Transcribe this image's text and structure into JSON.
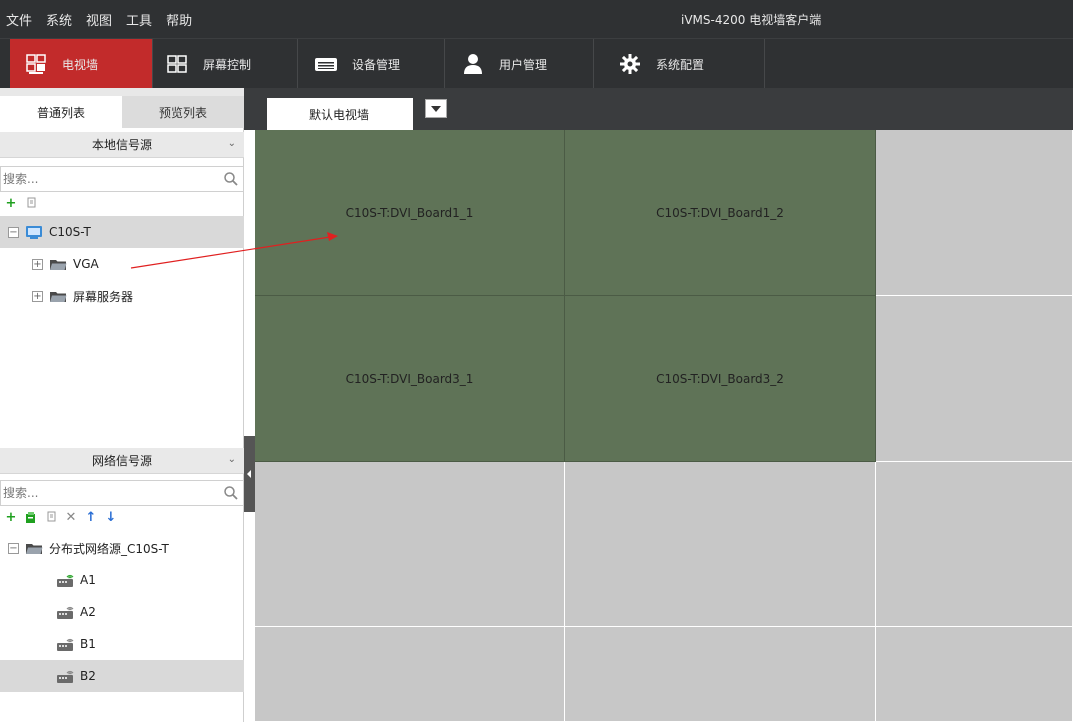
{
  "menu": {
    "items": [
      "文件",
      "系统",
      "视图",
      "工具",
      "帮助"
    ],
    "app_title": "iVMS-4200 电视墙客户端"
  },
  "toolbar": {
    "buttons": [
      {
        "label": "电视墙",
        "icon": "video-wall-icon",
        "active": true
      },
      {
        "label": "屏幕控制",
        "icon": "screen-grid-icon",
        "active": false
      },
      {
        "label": "设备管理",
        "icon": "device-icon",
        "active": false
      },
      {
        "label": "用户管理",
        "icon": "user-icon",
        "active": false
      },
      {
        "label": "系统配置",
        "icon": "gear-icon",
        "active": false
      }
    ]
  },
  "leftpanel": {
    "tabs": [
      "普通列表",
      "预览列表"
    ],
    "local": {
      "header": "本地信号源",
      "search_placeholder": "搜索...",
      "tree": [
        {
          "label": "C10S-T",
          "toggle": "−",
          "selected": true
        },
        {
          "label": "VGA",
          "toggle": "+"
        },
        {
          "label": "屏幕服务器",
          "toggle": "+"
        }
      ]
    },
    "network": {
      "header": "网络信号源",
      "search_placeholder": "搜索...",
      "tree_root": {
        "label": "分布式网络源_C10S-T",
        "toggle": "−"
      },
      "items": [
        "A1",
        "A2",
        "B1",
        "B2"
      ],
      "selected_item": "B2"
    }
  },
  "wall": {
    "tab_label": "默认电视墙",
    "cells": [
      {
        "label": "C10S-T:DVI_Board1_1",
        "on": true
      },
      {
        "label": "C10S-T:DVI_Board1_2",
        "on": true
      },
      {
        "label": "",
        "on": false
      },
      {
        "label": "C10S-T:DVI_Board3_1",
        "on": true
      },
      {
        "label": "C10S-T:DVI_Board3_2",
        "on": true
      },
      {
        "label": "",
        "on": false
      },
      {
        "label": "",
        "on": false
      },
      {
        "label": "",
        "on": false
      },
      {
        "label": "",
        "on": false
      },
      {
        "label": "",
        "on": false
      },
      {
        "label": "",
        "on": false
      },
      {
        "label": "",
        "on": false
      }
    ]
  },
  "colors": {
    "active_tab": "#c22b2b",
    "active_cell": "#5f7357",
    "idle_cell": "#c7c7c7",
    "drag_arrow": "#e02020"
  }
}
